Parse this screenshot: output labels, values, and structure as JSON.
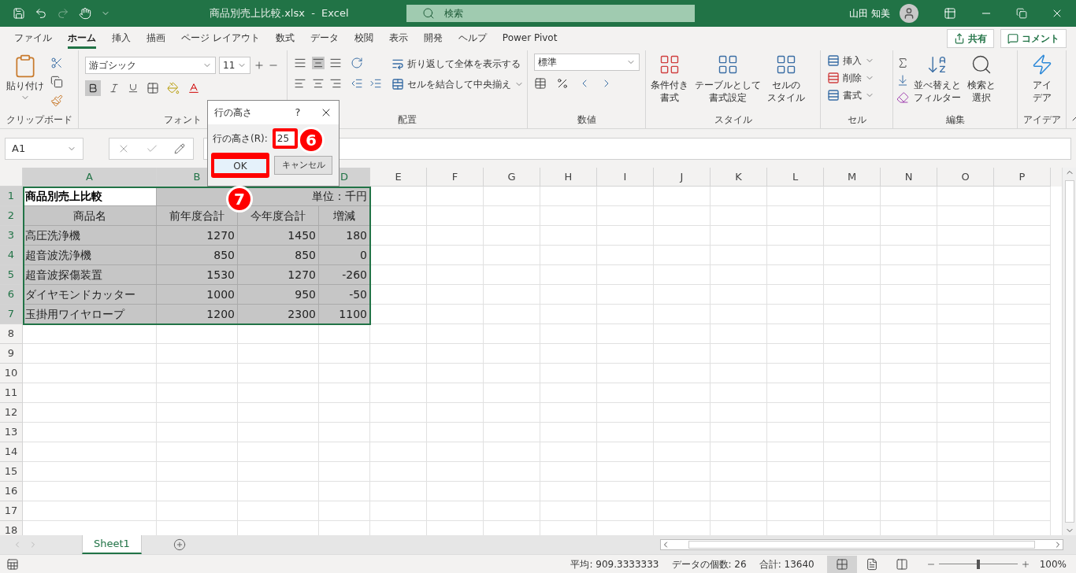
{
  "title_bar": {
    "document_title": "商品別売上比較.xlsx  -  Excel",
    "search": {
      "placeholder": "検索"
    },
    "user_name": "山田 知美"
  },
  "ribbon_tabs": [
    {
      "label": "ファイル",
      "selected": false
    },
    {
      "label": "ホーム",
      "selected": true
    },
    {
      "label": "挿入",
      "selected": false
    },
    {
      "label": "描画",
      "selected": false
    },
    {
      "label": "ページ レイアウト",
      "selected": false
    },
    {
      "label": "数式",
      "selected": false
    },
    {
      "label": "データ",
      "selected": false
    },
    {
      "label": "校閲",
      "selected": false
    },
    {
      "label": "表示",
      "selected": false
    },
    {
      "label": "開発",
      "selected": false
    },
    {
      "label": "ヘルプ",
      "selected": false
    },
    {
      "label": "Power Pivot",
      "selected": false
    }
  ],
  "share_button": "共有",
  "comment_button": "コメント",
  "ribbon": {
    "clipboard": {
      "paste": "貼り付け",
      "group_label": "クリップボード"
    },
    "font": {
      "font_name": "游ゴシック",
      "font_size": "11",
      "group_label": "フォント"
    },
    "alignment": {
      "wrap_text": "折り返して全体を表示する",
      "merge_center": "セルを結合して中央揃え",
      "group_label": "配置"
    },
    "number": {
      "format": "標準",
      "group_label": "数値"
    },
    "styles": {
      "buttons": [
        [
          "条件付き",
          "書式"
        ],
        [
          "テーブルとして",
          "書式設定"
        ],
        [
          "セルの",
          "スタイル"
        ]
      ],
      "group_label": "スタイル"
    },
    "cells": {
      "buttons": [
        "挿入",
        "削除",
        "書式"
      ],
      "group_label": "セル"
    },
    "editing": {
      "buttons": [
        [
          "並べ替えと",
          "フィルター"
        ],
        [
          "検索と",
          "選択"
        ]
      ],
      "group_label": "編集"
    },
    "ideas": {
      "button": [
        "アイ",
        "デア"
      ],
      "group_label": "アイデア"
    }
  },
  "formula_bar": {
    "name_box": "A1"
  },
  "columns": [
    {
      "label": "A",
      "selected": true
    },
    {
      "label": "B",
      "selected": true
    },
    {
      "label": "D",
      "selected": true
    },
    {
      "label": "E",
      "selected": false
    },
    {
      "label": "F",
      "selected": false
    },
    {
      "label": "G",
      "selected": false
    },
    {
      "label": "H",
      "selected": false
    },
    {
      "label": "I",
      "selected": false
    },
    {
      "label": "J",
      "selected": false
    },
    {
      "label": "K",
      "selected": false
    },
    {
      "label": "L",
      "selected": false
    },
    {
      "label": "M",
      "selected": false
    },
    {
      "label": "N",
      "selected": false
    },
    {
      "label": "O",
      "selected": false
    },
    {
      "label": "P",
      "selected": false
    }
  ],
  "rows": [
    {
      "number": "1",
      "selected": true,
      "cells": [
        {
          "text": "商品別売上比較",
          "active": true
        },
        {
          "text": "単位：千円",
          "active": false
        }
      ]
    },
    {
      "number": "2",
      "selected": true,
      "cells": [
        {
          "text": "商品名",
          "active": false
        },
        {
          "text": "前年度合計",
          "active": false
        },
        {
          "text": "今年度合計",
          "active": false
        },
        {
          "text": "増減",
          "active": false
        }
      ]
    },
    {
      "number": "3",
      "selected": true,
      "cells": [
        {
          "text": "高圧洗浄機",
          "active": false
        },
        {
          "text": "1270",
          "active": false
        },
        {
          "text": "1450",
          "active": false
        },
        {
          "text": "180",
          "active": false
        }
      ]
    },
    {
      "number": "4",
      "selected": true,
      "cells": [
        {
          "text": "超音波洗浄機",
          "active": false
        },
        {
          "text": "850",
          "active": false
        },
        {
          "text": "850",
          "active": false
        },
        {
          "text": "0",
          "active": false
        }
      ]
    },
    {
      "number": "5",
      "selected": true,
      "cells": [
        {
          "text": "超音波探傷装置",
          "active": false
        },
        {
          "text": "1530",
          "active": false
        },
        {
          "text": "1270",
          "active": false
        },
        {
          "text": "-260",
          "active": false
        }
      ]
    },
    {
      "number": "6",
      "selected": true,
      "cells": [
        {
          "text": "ダイヤモンドカッター",
          "active": false
        },
        {
          "text": "1000",
          "active": false
        },
        {
          "text": "950",
          "active": false
        },
        {
          "text": "-50",
          "active": false
        }
      ]
    },
    {
      "number": "7",
      "selected": true,
      "cells": [
        {
          "text": "玉掛用ワイヤロープ",
          "active": false
        },
        {
          "text": "1200",
          "active": false
        },
        {
          "text": "2300",
          "active": false
        },
        {
          "text": "1100",
          "active": false
        }
      ]
    },
    {
      "number": "8",
      "selected": false
    },
    {
      "number": "9",
      "selected": false
    },
    {
      "number": "10",
      "selected": false
    },
    {
      "number": "11",
      "selected": false
    },
    {
      "number": "12",
      "selected": false
    },
    {
      "number": "13",
      "selected": false
    },
    {
      "number": "14",
      "selected": false
    },
    {
      "number": "15",
      "selected": false
    },
    {
      "number": "16",
      "selected": false
    },
    {
      "number": "17",
      "selected": false
    },
    {
      "number": "18",
      "selected": false
    }
  ],
  "dialog": {
    "title": "行の高さ",
    "help": "?",
    "field_label": "行の高さ(R):",
    "value": "25",
    "ok_button": "OK",
    "cancel_button": "キャンセル"
  },
  "annotations": [
    {
      "label": "6"
    },
    {
      "label": "7"
    }
  ],
  "sheet_tabs": [
    {
      "label": "Sheet1",
      "selected": true
    }
  ],
  "status_bar": {
    "average": "平均: 909.3333333",
    "count": "データの個数: 26",
    "sum": "合計: 13640",
    "views": [
      {
        "kind": "normal",
        "selected": true
      },
      {
        "kind": "page_layout",
        "selected": false
      },
      {
        "kind": "page_break",
        "selected": false
      }
    ],
    "zoom": {
      "level": 0.5,
      "label": "100%"
    }
  }
}
